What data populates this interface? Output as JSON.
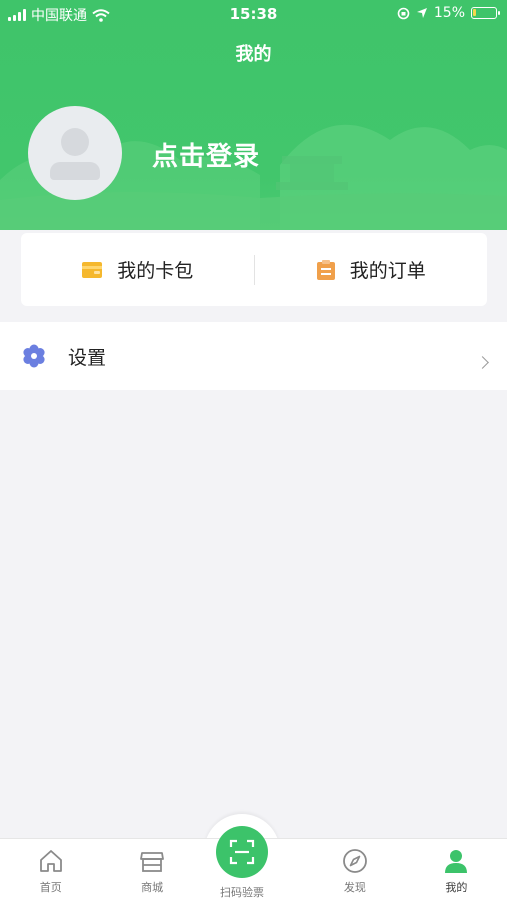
{
  "status_bar": {
    "carrier": "中国联通",
    "time": "15:38",
    "battery_percent": "15%",
    "battery_level": 0.15
  },
  "header": {
    "title": "我的",
    "login_prompt": "点击登录"
  },
  "quick_actions": {
    "card_pack": {
      "label": "我的卡包",
      "icon": "wallet-icon"
    },
    "orders": {
      "label": "我的订单",
      "icon": "clipboard-icon"
    }
  },
  "settings": {
    "label": "设置",
    "icon": "gear-icon"
  },
  "tabbar": {
    "home": "首页",
    "mall": "商城",
    "scan": "扫码验票",
    "discover": "发现",
    "mine": "我的"
  },
  "colors": {
    "brand_green": "#3fc46a",
    "wallet_yellow": "#f5b82e",
    "clipboard_orange": "#f0a04b",
    "settings_blue": "#6b7fe0"
  }
}
